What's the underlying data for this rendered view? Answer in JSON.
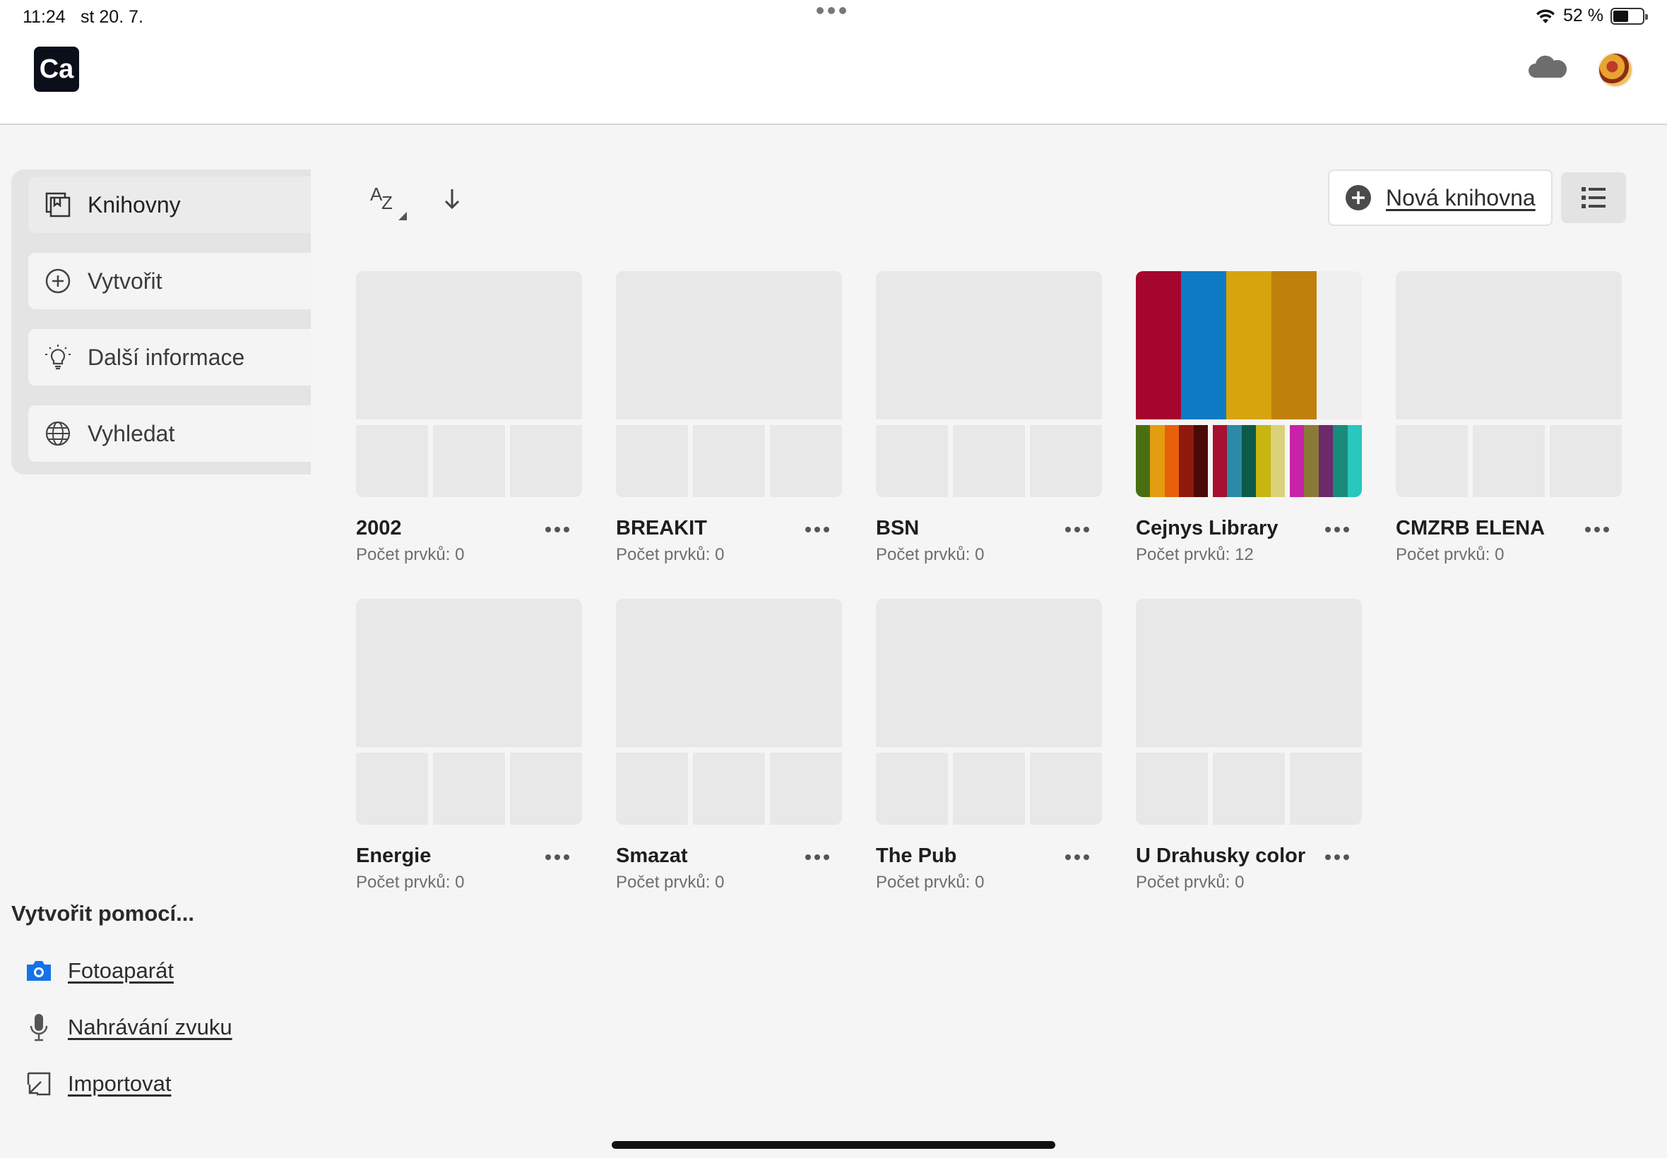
{
  "status": {
    "time": "11:24",
    "date": "st 20. 7.",
    "battery": "52 %",
    "battery_level": 0.52
  },
  "app": {
    "logo": "Ca",
    "cloud_icon": "cloud-icon",
    "avatar_icon": "avatar"
  },
  "sidebar": {
    "items": [
      {
        "label": "Knihovny",
        "icon": "library-icon",
        "active": true
      },
      {
        "label": "Vytvořit",
        "icon": "add-circle-icon",
        "active": false
      },
      {
        "label": "Další informace",
        "icon": "lightbulb-icon",
        "active": false
      },
      {
        "label": "Vyhledat",
        "icon": "globe-icon",
        "active": false
      }
    ]
  },
  "create_with": {
    "title": "Vytvořit pomocí...",
    "items": [
      {
        "label": "Fotoaparát",
        "icon": "camera-icon"
      },
      {
        "label": "Nahrávání zvuku",
        "icon": "microphone-icon"
      },
      {
        "label": "Importovat",
        "icon": "import-icon"
      }
    ]
  },
  "toolbar": {
    "sort_label": "AZ",
    "new_library": "Nová knihovna"
  },
  "libraries": [
    {
      "name": "2002",
      "count": "Počet prvků: 0"
    },
    {
      "name": "BREAKIT",
      "count": "Počet prvků: 0"
    },
    {
      "name": "BSN",
      "count": "Počet prvků: 0"
    },
    {
      "name": "Cejnys Library",
      "count": "Počet prvků: 12"
    },
    {
      "name": "CMZRB ELENA",
      "count": "Počet prvků: 0"
    },
    {
      "name": "Energie",
      "count": "Počet prvků: 0"
    },
    {
      "name": "Smazat",
      "count": "Počet prvků: 0"
    },
    {
      "name": "The Pub",
      "count": "Počet prvků: 0"
    },
    {
      "name": "U Drahusky color",
      "count": "Počet prvků: 0"
    }
  ],
  "colors": {
    "cejnys_main": [
      "#a5062d",
      "#0f7ac4",
      "#d6a40c",
      "#c0800c",
      "#efefef"
    ],
    "cejnys_small1": [
      "#4a6f12",
      "#e39d10",
      "#e8600c",
      "#8e1a0c",
      "#4a0a08"
    ],
    "cejnys_small2": [
      "#a81030",
      "#2a8aa8",
      "#0d5a4a",
      "#c8b610",
      "#d9d27a"
    ],
    "cejnys_small3": [
      "#c822a8",
      "#8a7a3a",
      "#6b2a6a",
      "#1a8a7a",
      "#2ac6c0"
    ]
  }
}
